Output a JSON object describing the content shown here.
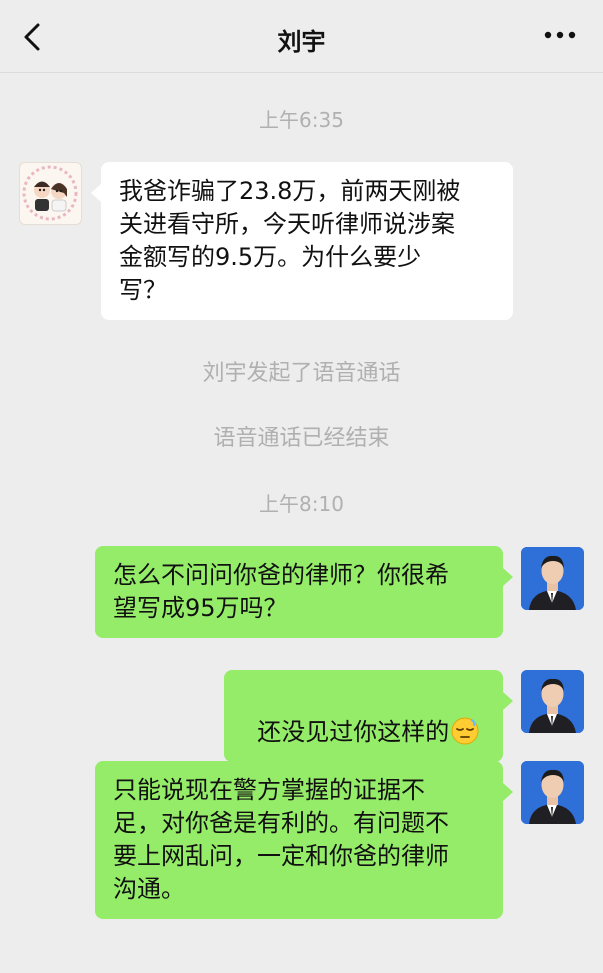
{
  "header": {
    "title": "刘宇",
    "back_icon": "chevron-left-icon",
    "more_icon": "more-dots-icon"
  },
  "messages": {
    "time1": "上午6:35",
    "peer_msg1": "我爸诈骗了23.8万，前两天刚被\n关进看守所，今天听律师说涉案\n金额写的9.5万。为什么要少\n写？",
    "sys_call_started": "刘宇发起了语音通话",
    "sys_call_ended": "语音通话已经结束",
    "time2": "上午8:10",
    "me_msg1": "怎么不问问你爸的律师？你很希\n望写成95万吗？",
    "me_msg2": "还没见过你这样的",
    "me_msg2_emoji": "sleepy-face-emoji",
    "me_msg3": "只能说现在警方掌握的证据不\n足，对你爸是有利的。有问题不\n要上网乱问，一定和你爸的律师\n沟通。"
  },
  "colors": {
    "background": "#ededed",
    "my_bubble": "#95ec69",
    "peer_bubble": "#ffffff",
    "system_text": "#b0b0b0"
  }
}
